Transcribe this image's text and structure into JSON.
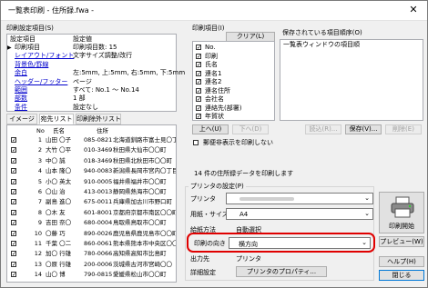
{
  "window": {
    "title": "一覧表印刷 - 住所録.fwa -",
    "close_glyph": "✕"
  },
  "settings": {
    "group_label": "印刷設定項目(S)",
    "header_item": "設定項目",
    "header_value": "設定値",
    "rows": [
      {
        "item": "印刷項目",
        "value": "印刷項目数: 15",
        "link": false,
        "selected": true
      },
      {
        "item": "レイアウト/フォント",
        "value": "文字サイズ調整/改行",
        "link": true
      },
      {
        "item": "背景色/罫線",
        "value": "",
        "link": true
      },
      {
        "item": "余白",
        "value": "左:5mm, 上:5mm, 右:5mm, 下:5mm",
        "link": true
      },
      {
        "item": "ヘッダー/フッター",
        "value": "ページ",
        "link": true
      },
      {
        "item": "範囲",
        "value": "すべて: No.1 〜 No.14",
        "link": true
      },
      {
        "item": "部数",
        "value": "1 部",
        "link": true
      },
      {
        "item": "条件",
        "value": "設定なし",
        "link": true
      }
    ]
  },
  "tabs": [
    {
      "label": "イメージ",
      "selected": false
    },
    {
      "label": "宛先リスト",
      "selected": true
    },
    {
      "label": "印刷除外リスト",
      "selected": false
    }
  ],
  "list": {
    "headers": {
      "no": "No",
      "name": "氏名",
      "addr": "住所"
    },
    "rows": [
      {
        "no": "1",
        "name": "山田 〇子",
        "zip": "085-0821",
        "addr": "北海道釧路市富士見〇丁目"
      },
      {
        "no": "2",
        "name": "大竹 〇平",
        "zip": "010-3469",
        "addr": "秋田県大仙市〇〇町"
      },
      {
        "no": "3",
        "name": "中〇 誠",
        "zip": "018-3469",
        "addr": "秋田県北秋田市〇〇町"
      },
      {
        "no": "4",
        "name": "山本 隆〇",
        "zip": "940-0083",
        "addr": "新潟県長岡市宮内〇丁目"
      },
      {
        "no": "5",
        "name": "小〇 英太",
        "zip": "910-0005",
        "addr": "福井県福井市〇〇町"
      },
      {
        "no": "6",
        "name": "〇山 治",
        "zip": "413-0013",
        "addr": "静岡県熱海市〇〇町"
      },
      {
        "no": "7",
        "name": "副島 進〇",
        "zip": "675-0011",
        "addr": "兵庫県加古川市野口町"
      },
      {
        "no": "8",
        "name": "〇木 友",
        "zip": "601-8001",
        "addr": "京都府京都市南区〇〇町"
      },
      {
        "no": "9",
        "name": "吉田 奈〇",
        "zip": "680-0004",
        "addr": "鳥取県鳥取市〇〇町"
      },
      {
        "no": "10",
        "name": "〇藤 巧",
        "zip": "890-0026",
        "addr": "鹿児島県鹿児島市〇〇町"
      },
      {
        "no": "11",
        "name": "千葉 〇二",
        "zip": "860-0061",
        "addr": "熊本県熊本市中央区〇〇"
      },
      {
        "no": "12",
        "name": "加〇 行雄",
        "zip": "780-0066",
        "addr": "高知県高知市比島町"
      },
      {
        "no": "13",
        "name": "〇原 行雄",
        "zip": "200-0006",
        "addr": "茨城県古河市宮崎〇〇"
      },
      {
        "no": "14",
        "name": "山〇 博",
        "zip": "790-0815",
        "addr": "愛媛県松山市〇〇町"
      }
    ]
  },
  "print_items": {
    "group_label": "印刷項目(I)",
    "clear_label": "クリア(L)",
    "items": [
      "No.",
      "印刷",
      "氏名",
      "連名1",
      "連名2",
      "連名住所",
      "会社名",
      "連絡先(部署)",
      "年賀状"
    ],
    "up_label": "上へ(U)",
    "down_label": "下へ(D)"
  },
  "saved": {
    "label": "保存されている項目順序(O)",
    "items": [
      "一覧表ウィンドウの項目順"
    ],
    "load_label": "読込(R)...",
    "save_label": "保存(V)...",
    "delete_label": "削除(E)"
  },
  "exclude_checkbox": "郵便非表示を印刷しない",
  "count_text": "14 件の住所録データを印刷します",
  "printer_group": {
    "label": "プリンタの設定(P)",
    "printer_label": "プリンタ",
    "paper_label": "用紙・サイズ",
    "paper_value": "A4",
    "feed_label": "給紙方法",
    "feed_value": "自動選択",
    "orientation_label": "印刷の向き",
    "orientation_value": "横方向",
    "output_label": "出力先",
    "output_value": "プリンタ",
    "detail_label": "詳細設定",
    "properties_label": "プリンタのプロパティ...",
    "accent": "#e00000"
  },
  "actions": {
    "print_start": "印刷開始",
    "preview": "プレビュー(W)",
    "help": "ヘルプ(H)",
    "close": "閉じる"
  }
}
